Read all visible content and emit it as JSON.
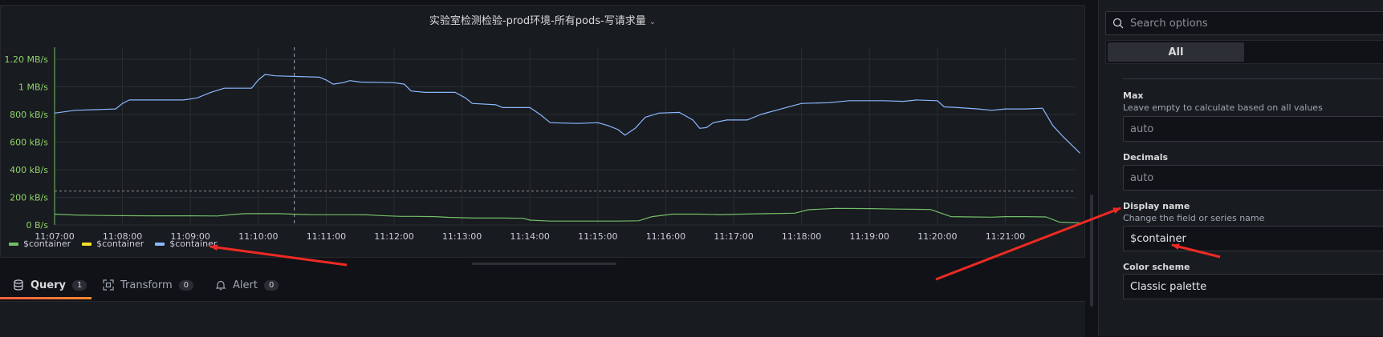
{
  "panel": {
    "title": "实验室检测检验-prod环境-所有pods-写请求量",
    "title_chevron": "⌄"
  },
  "chart_data": {
    "type": "line",
    "x_ticks": [
      "11:07:00",
      "11:08:00",
      "11:09:00",
      "11:10:00",
      "11:11:00",
      "11:12:00",
      "11:13:00",
      "11:14:00",
      "11:15:00",
      "11:16:00",
      "11:17:00",
      "11:18:00",
      "11:19:00",
      "11:20:00",
      "11:21:00"
    ],
    "y_ticks": [
      "0 B/s",
      "200 kB/s",
      "400 kB/s",
      "600 kB/s",
      "800 kB/s",
      "1 MB/s",
      "1.20 MB/s"
    ],
    "ylim": [
      0,
      1200
    ],
    "xlim": [
      0,
      15.1
    ],
    "threshold": 245,
    "hover_x": 3.53,
    "series": [
      {
        "name": "$container",
        "color": "#73bf69",
        "points": [
          [
            0,
            78
          ],
          [
            0.3,
            72
          ],
          [
            0.8,
            68
          ],
          [
            1.4,
            66
          ],
          [
            2.0,
            66
          ],
          [
            2.4,
            65
          ],
          [
            2.6,
            75
          ],
          [
            2.8,
            82
          ],
          [
            3.3,
            82
          ],
          [
            3.5,
            78
          ],
          [
            3.8,
            74
          ],
          [
            4.3,
            74
          ],
          [
            4.6,
            73
          ],
          [
            4.8,
            68
          ],
          [
            5.1,
            62
          ],
          [
            5.3,
            62
          ],
          [
            5.6,
            60
          ],
          [
            5.8,
            55
          ],
          [
            6.0,
            52
          ],
          [
            6.2,
            50
          ],
          [
            6.6,
            50
          ],
          [
            6.9,
            48
          ],
          [
            7.0,
            35
          ],
          [
            7.3,
            28
          ],
          [
            7.8,
            28
          ],
          [
            8.3,
            28
          ],
          [
            8.6,
            30
          ],
          [
            8.8,
            60
          ],
          [
            9.1,
            78
          ],
          [
            9.5,
            78
          ],
          [
            9.8,
            75
          ],
          [
            10.1,
            78
          ],
          [
            10.5,
            82
          ],
          [
            10.9,
            85
          ],
          [
            11.1,
            110
          ],
          [
            11.5,
            120
          ],
          [
            12.0,
            118
          ],
          [
            12.4,
            115
          ],
          [
            12.9,
            112
          ],
          [
            13.2,
            60
          ],
          [
            13.5,
            58
          ],
          [
            13.8,
            56
          ],
          [
            14.0,
            60
          ],
          [
            14.3,
            60
          ],
          [
            14.6,
            58
          ],
          [
            14.8,
            20
          ],
          [
            15.1,
            15
          ]
        ]
      },
      {
        "name": "$container",
        "color": "#fade2a",
        "points": []
      },
      {
        "name": "$container",
        "color": "#8ab8ff",
        "points": [
          [
            0,
            810
          ],
          [
            0.3,
            830
          ],
          [
            0.6,
            835
          ],
          [
            0.9,
            840
          ],
          [
            1.0,
            880
          ],
          [
            1.1,
            905
          ],
          [
            1.5,
            905
          ],
          [
            1.9,
            905
          ],
          [
            2.1,
            920
          ],
          [
            2.3,
            960
          ],
          [
            2.5,
            990
          ],
          [
            2.9,
            990
          ],
          [
            3.0,
            1050
          ],
          [
            3.1,
            1090
          ],
          [
            3.25,
            1080
          ],
          [
            3.6,
            1075
          ],
          [
            3.9,
            1070
          ],
          [
            4.0,
            1050
          ],
          [
            4.1,
            1020
          ],
          [
            4.25,
            1030
          ],
          [
            4.35,
            1045
          ],
          [
            4.5,
            1035
          ],
          [
            5.0,
            1030
          ],
          [
            5.15,
            1020
          ],
          [
            5.25,
            970
          ],
          [
            5.45,
            960
          ],
          [
            5.9,
            960
          ],
          [
            6.05,
            920
          ],
          [
            6.15,
            880
          ],
          [
            6.5,
            870
          ],
          [
            6.6,
            850
          ],
          [
            7.0,
            850
          ],
          [
            7.15,
            800
          ],
          [
            7.3,
            740
          ],
          [
            7.7,
            735
          ],
          [
            8.0,
            740
          ],
          [
            8.15,
            720
          ],
          [
            8.3,
            690
          ],
          [
            8.4,
            650
          ],
          [
            8.55,
            700
          ],
          [
            8.7,
            780
          ],
          [
            8.9,
            810
          ],
          [
            9.2,
            815
          ],
          [
            9.4,
            760
          ],
          [
            9.5,
            700
          ],
          [
            9.6,
            705
          ],
          [
            9.7,
            740
          ],
          [
            9.9,
            760
          ],
          [
            10.2,
            760
          ],
          [
            10.4,
            800
          ],
          [
            10.7,
            840
          ],
          [
            11.0,
            880
          ],
          [
            11.4,
            885
          ],
          [
            11.7,
            900
          ],
          [
            12.2,
            900
          ],
          [
            12.5,
            895
          ],
          [
            12.7,
            905
          ],
          [
            13.0,
            900
          ],
          [
            13.1,
            855
          ],
          [
            13.3,
            850
          ],
          [
            13.6,
            840
          ],
          [
            13.8,
            830
          ],
          [
            14.0,
            840
          ],
          [
            14.3,
            840
          ],
          [
            14.55,
            845
          ],
          [
            14.7,
            720
          ],
          [
            14.85,
            640
          ],
          [
            15.1,
            520
          ]
        ]
      }
    ]
  },
  "legend": [
    {
      "label": "$container",
      "color": "#73bf69"
    },
    {
      "label": "$container",
      "color": "#fade2a"
    },
    {
      "label": "$container",
      "color": "#8ab8ff"
    }
  ],
  "tabs": [
    {
      "label": "Query",
      "count": "1",
      "icon": "database-icon"
    },
    {
      "label": "Transform",
      "count": "0",
      "icon": "transform-icon"
    },
    {
      "label": "Alert",
      "count": "0",
      "icon": "bell-icon"
    }
  ],
  "options": {
    "search_placeholder": "Search options",
    "all_label": "All",
    "max_label": "Max",
    "max_desc": "Leave empty to calculate based on all values",
    "max_value": "auto",
    "decimals_label": "Decimals",
    "decimals_value": "auto",
    "display_name_label": "Display name",
    "display_name_desc": "Change the field or series name",
    "display_name_value": "$container",
    "color_scheme_label": "Color scheme",
    "color_scheme_value": "Classic palette"
  },
  "colors": {
    "annotation_arrow": "#ee2a24",
    "accent": "#f55f3e"
  }
}
